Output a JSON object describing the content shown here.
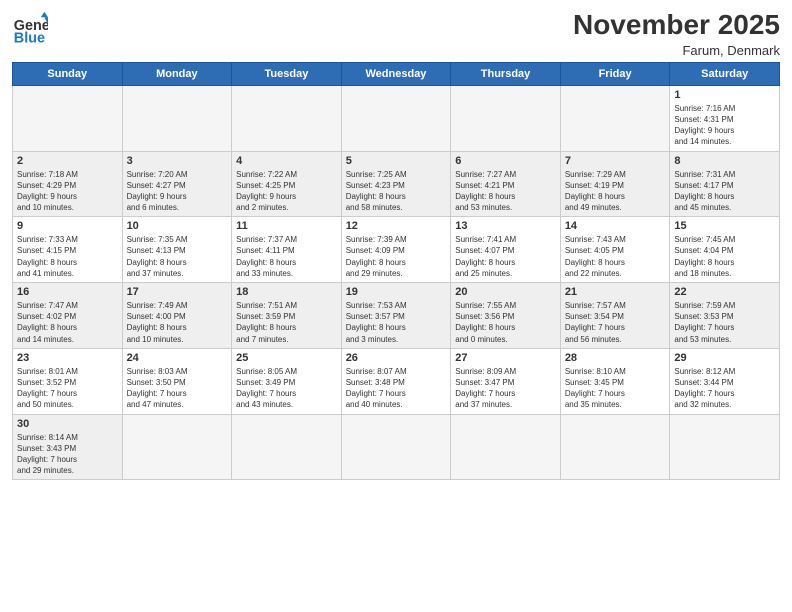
{
  "header": {
    "logo_general": "General",
    "logo_blue": "Blue",
    "month_year": "November 2025",
    "location": "Farum, Denmark"
  },
  "days_of_week": [
    "Sunday",
    "Monday",
    "Tuesday",
    "Wednesday",
    "Thursday",
    "Friday",
    "Saturday"
  ],
  "weeks": [
    [
      {
        "num": "",
        "info": "",
        "empty": true
      },
      {
        "num": "",
        "info": "",
        "empty": true
      },
      {
        "num": "",
        "info": "",
        "empty": true
      },
      {
        "num": "",
        "info": "",
        "empty": true
      },
      {
        "num": "",
        "info": "",
        "empty": true
      },
      {
        "num": "",
        "info": "",
        "empty": true
      },
      {
        "num": "1",
        "info": "Sunrise: 7:16 AM\nSunset: 4:31 PM\nDaylight: 9 hours\nand 14 minutes."
      }
    ],
    [
      {
        "num": "2",
        "info": "Sunrise: 7:18 AM\nSunset: 4:29 PM\nDaylight: 9 hours\nand 10 minutes."
      },
      {
        "num": "3",
        "info": "Sunrise: 7:20 AM\nSunset: 4:27 PM\nDaylight: 9 hours\nand 6 minutes."
      },
      {
        "num": "4",
        "info": "Sunrise: 7:22 AM\nSunset: 4:25 PM\nDaylight: 9 hours\nand 2 minutes."
      },
      {
        "num": "5",
        "info": "Sunrise: 7:25 AM\nSunset: 4:23 PM\nDaylight: 8 hours\nand 58 minutes."
      },
      {
        "num": "6",
        "info": "Sunrise: 7:27 AM\nSunset: 4:21 PM\nDaylight: 8 hours\nand 53 minutes."
      },
      {
        "num": "7",
        "info": "Sunrise: 7:29 AM\nSunset: 4:19 PM\nDaylight: 8 hours\nand 49 minutes."
      },
      {
        "num": "8",
        "info": "Sunrise: 7:31 AM\nSunset: 4:17 PM\nDaylight: 8 hours\nand 45 minutes."
      }
    ],
    [
      {
        "num": "9",
        "info": "Sunrise: 7:33 AM\nSunset: 4:15 PM\nDaylight: 8 hours\nand 41 minutes."
      },
      {
        "num": "10",
        "info": "Sunrise: 7:35 AM\nSunset: 4:13 PM\nDaylight: 8 hours\nand 37 minutes."
      },
      {
        "num": "11",
        "info": "Sunrise: 7:37 AM\nSunset: 4:11 PM\nDaylight: 8 hours\nand 33 minutes."
      },
      {
        "num": "12",
        "info": "Sunrise: 7:39 AM\nSunset: 4:09 PM\nDaylight: 8 hours\nand 29 minutes."
      },
      {
        "num": "13",
        "info": "Sunrise: 7:41 AM\nSunset: 4:07 PM\nDaylight: 8 hours\nand 25 minutes."
      },
      {
        "num": "14",
        "info": "Sunrise: 7:43 AM\nSunset: 4:05 PM\nDaylight: 8 hours\nand 22 minutes."
      },
      {
        "num": "15",
        "info": "Sunrise: 7:45 AM\nSunset: 4:04 PM\nDaylight: 8 hours\nand 18 minutes."
      }
    ],
    [
      {
        "num": "16",
        "info": "Sunrise: 7:47 AM\nSunset: 4:02 PM\nDaylight: 8 hours\nand 14 minutes."
      },
      {
        "num": "17",
        "info": "Sunrise: 7:49 AM\nSunset: 4:00 PM\nDaylight: 8 hours\nand 10 minutes."
      },
      {
        "num": "18",
        "info": "Sunrise: 7:51 AM\nSunset: 3:59 PM\nDaylight: 8 hours\nand 7 minutes."
      },
      {
        "num": "19",
        "info": "Sunrise: 7:53 AM\nSunset: 3:57 PM\nDaylight: 8 hours\nand 3 minutes."
      },
      {
        "num": "20",
        "info": "Sunrise: 7:55 AM\nSunset: 3:56 PM\nDaylight: 8 hours\nand 0 minutes."
      },
      {
        "num": "21",
        "info": "Sunrise: 7:57 AM\nSunset: 3:54 PM\nDaylight: 7 hours\nand 56 minutes."
      },
      {
        "num": "22",
        "info": "Sunrise: 7:59 AM\nSunset: 3:53 PM\nDaylight: 7 hours\nand 53 minutes."
      }
    ],
    [
      {
        "num": "23",
        "info": "Sunrise: 8:01 AM\nSunset: 3:52 PM\nDaylight: 7 hours\nand 50 minutes."
      },
      {
        "num": "24",
        "info": "Sunrise: 8:03 AM\nSunset: 3:50 PM\nDaylight: 7 hours\nand 47 minutes."
      },
      {
        "num": "25",
        "info": "Sunrise: 8:05 AM\nSunset: 3:49 PM\nDaylight: 7 hours\nand 43 minutes."
      },
      {
        "num": "26",
        "info": "Sunrise: 8:07 AM\nSunset: 3:48 PM\nDaylight: 7 hours\nand 40 minutes."
      },
      {
        "num": "27",
        "info": "Sunrise: 8:09 AM\nSunset: 3:47 PM\nDaylight: 7 hours\nand 37 minutes."
      },
      {
        "num": "28",
        "info": "Sunrise: 8:10 AM\nSunset: 3:45 PM\nDaylight: 7 hours\nand 35 minutes."
      },
      {
        "num": "29",
        "info": "Sunrise: 8:12 AM\nSunset: 3:44 PM\nDaylight: 7 hours\nand 32 minutes."
      }
    ],
    [
      {
        "num": "30",
        "info": "Sunrise: 8:14 AM\nSunset: 3:43 PM\nDaylight: 7 hours\nand 29 minutes."
      },
      {
        "num": "",
        "info": "",
        "empty": true
      },
      {
        "num": "",
        "info": "",
        "empty": true
      },
      {
        "num": "",
        "info": "",
        "empty": true
      },
      {
        "num": "",
        "info": "",
        "empty": true
      },
      {
        "num": "",
        "info": "",
        "empty": true
      },
      {
        "num": "",
        "info": "",
        "empty": true
      }
    ]
  ]
}
